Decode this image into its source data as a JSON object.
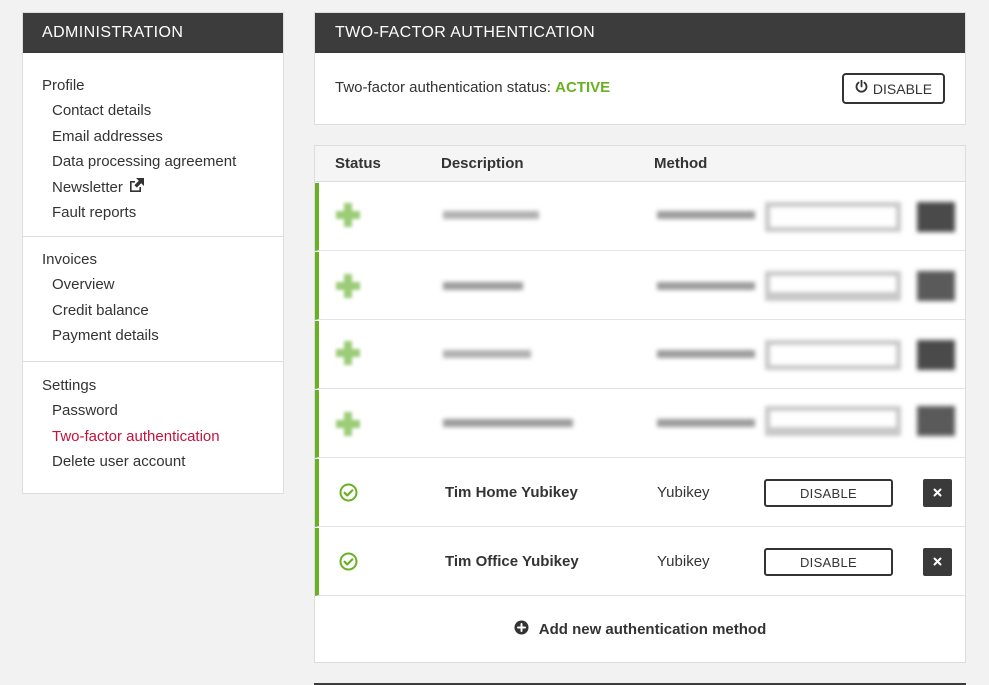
{
  "sidebar": {
    "title": "ADMINISTRATION",
    "groups": [
      {
        "title": "Profile",
        "items": [
          "Contact details",
          "Email addresses",
          "Data processing agreement",
          "Newsletter",
          "Fault reports"
        ]
      },
      {
        "title": "Invoices",
        "items": [
          "Overview",
          "Credit balance",
          "Payment details"
        ]
      },
      {
        "title": "Settings",
        "items": [
          "Password",
          "Two-factor authentication",
          "Delete user account"
        ]
      }
    ],
    "active_item": "Two-factor authentication",
    "active_color": "#c4123d"
  },
  "twofa": {
    "title": "TWO-FACTOR AUTHENTICATION",
    "status_label": "Two-factor authentication status:",
    "status_value": "ACTIVE",
    "status_color": "#6ab023",
    "disable_label": "DISABLE",
    "disable_icon": "power-icon"
  },
  "table": {
    "headers": {
      "status": "Status",
      "description": "Description",
      "method": "Method"
    },
    "rows": [
      {
        "description": "Tim Home Yubikey",
        "method": "Yubikey",
        "action": "DISABLE"
      },
      {
        "description": "Tim Office Yubikey",
        "method": "Yubikey",
        "action": "DISABLE"
      }
    ],
    "add_label": "Add new authentication method",
    "accent_color": "#6ab023"
  }
}
